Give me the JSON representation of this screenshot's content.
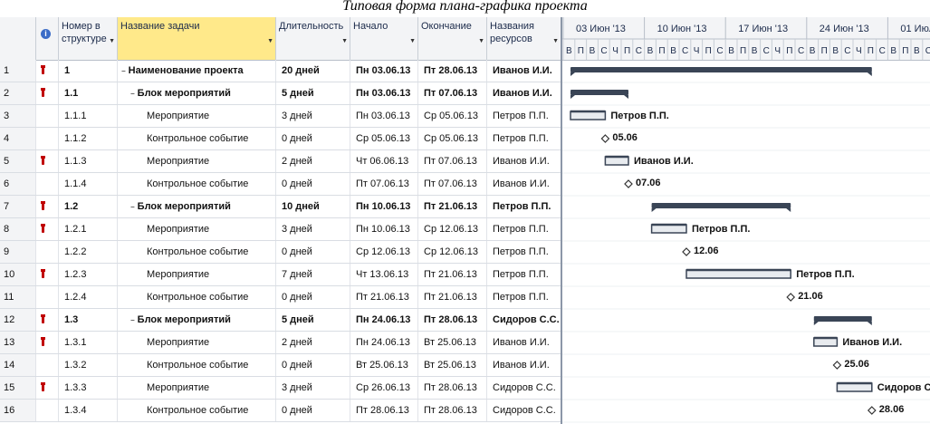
{
  "caption": "Типовая форма плана-графика проекта",
  "columns": {
    "num": "",
    "info_icon": "info-icon",
    "wbs": "Номер в структуре",
    "name": "Название задачи",
    "duration": "Длительность",
    "start": "Начало",
    "finish": "Окончание",
    "resources": "Названия ресурсов"
  },
  "timescale": {
    "weeks": [
      "03 Июн '13",
      "10 Июн '13",
      "17 Июн '13",
      "24 Июн '13",
      "01 Июл '"
    ],
    "days": [
      "В",
      "П",
      "В",
      "С",
      "Ч",
      "П",
      "С"
    ]
  },
  "rows": [
    {
      "num": "1",
      "flag": true,
      "wbs": "1",
      "name": "Наименование проекта",
      "duration": "20 дней",
      "start": "Пн 03.06.13",
      "finish": "Пт 28.06.13",
      "res": "Иванов И.И.",
      "level": 0,
      "type": "summary",
      "bar": {
        "s": 0,
        "e": 26
      },
      "label": ""
    },
    {
      "num": "2",
      "flag": true,
      "wbs": "1.1",
      "name": "Блок мероприятий",
      "duration": "5 дней",
      "start": "Пн 03.06.13",
      "finish": "Пт 07.06.13",
      "res": "Иванов И.И.",
      "level": 1,
      "type": "summary",
      "bar": {
        "s": 0,
        "e": 5
      },
      "label": ""
    },
    {
      "num": "3",
      "flag": false,
      "wbs": "1.1.1",
      "name": "Мероприятие",
      "duration": "3 дней",
      "start": "Пн 03.06.13",
      "finish": "Ср 05.06.13",
      "res": "Петров П.П.",
      "level": 2,
      "type": "task",
      "bar": {
        "s": 0,
        "e": 3
      },
      "label": "Петров П.П."
    },
    {
      "num": "4",
      "flag": false,
      "wbs": "1.1.2",
      "name": "Контрольное событие",
      "duration": "0 дней",
      "start": "Ср 05.06.13",
      "finish": "Ср 05.06.13",
      "res": "Петров П.П.",
      "level": 2,
      "type": "milestone",
      "bar": {
        "s": 3,
        "e": 3
      },
      "label": "05.06"
    },
    {
      "num": "5",
      "flag": true,
      "wbs": "1.1.3",
      "name": "Мероприятие",
      "duration": "2 дней",
      "start": "Чт 06.06.13",
      "finish": "Пт 07.06.13",
      "res": "Иванов И.И.",
      "level": 2,
      "type": "task",
      "bar": {
        "s": 3,
        "e": 5
      },
      "label": "Иванов И.И."
    },
    {
      "num": "6",
      "flag": false,
      "wbs": "1.1.4",
      "name": "Контрольное событие",
      "duration": "0 дней",
      "start": "Пт 07.06.13",
      "finish": "Пт 07.06.13",
      "res": "Иванов И.И.",
      "level": 2,
      "type": "milestone",
      "bar": {
        "s": 5,
        "e": 5
      },
      "label": "07.06"
    },
    {
      "num": "7",
      "flag": true,
      "wbs": "1.2",
      "name": "Блок мероприятий",
      "duration": "10 дней",
      "start": "Пн 10.06.13",
      "finish": "Пт 21.06.13",
      "res": "Петров П.П.",
      "level": 1,
      "type": "summary",
      "bar": {
        "s": 7,
        "e": 19
      },
      "label": ""
    },
    {
      "num": "8",
      "flag": true,
      "wbs": "1.2.1",
      "name": "Мероприятие",
      "duration": "3 дней",
      "start": "Пн 10.06.13",
      "finish": "Ср 12.06.13",
      "res": "Петров П.П.",
      "level": 2,
      "type": "task",
      "bar": {
        "s": 7,
        "e": 10
      },
      "label": "Петров П.П."
    },
    {
      "num": "9",
      "flag": false,
      "wbs": "1.2.2",
      "name": "Контрольное событие",
      "duration": "0 дней",
      "start": "Ср 12.06.13",
      "finish": "Ср 12.06.13",
      "res": "Петров П.П.",
      "level": 2,
      "type": "milestone",
      "bar": {
        "s": 10,
        "e": 10
      },
      "label": "12.06"
    },
    {
      "num": "10",
      "flag": true,
      "wbs": "1.2.3",
      "name": "Мероприятие",
      "duration": "7 дней",
      "start": "Чт 13.06.13",
      "finish": "Пт 21.06.13",
      "res": "Петров П.П.",
      "level": 2,
      "type": "task",
      "bar": {
        "s": 10,
        "e": 19
      },
      "label": "Петров П.П."
    },
    {
      "num": "11",
      "flag": false,
      "wbs": "1.2.4",
      "name": "Контрольное событие",
      "duration": "0 дней",
      "start": "Пт 21.06.13",
      "finish": "Пт 21.06.13",
      "res": "Петров П.П.",
      "level": 2,
      "type": "milestone",
      "bar": {
        "s": 19,
        "e": 19
      },
      "label": "21.06"
    },
    {
      "num": "12",
      "flag": true,
      "wbs": "1.3",
      "name": "Блок мероприятий",
      "duration": "5 дней",
      "start": "Пн 24.06.13",
      "finish": "Пт 28.06.13",
      "res": "Сидоров С.С.",
      "level": 1,
      "type": "summary",
      "bar": {
        "s": 21,
        "e": 26
      },
      "label": ""
    },
    {
      "num": "13",
      "flag": true,
      "wbs": "1.3.1",
      "name": "Мероприятие",
      "duration": "2 дней",
      "start": "Пн 24.06.13",
      "finish": "Вт 25.06.13",
      "res": "Иванов И.И.",
      "level": 2,
      "type": "task",
      "bar": {
        "s": 21,
        "e": 23
      },
      "label": "Иванов И.И."
    },
    {
      "num": "14",
      "flag": false,
      "wbs": "1.3.2",
      "name": "Контрольное событие",
      "duration": "0 дней",
      "start": "Вт 25.06.13",
      "finish": "Вт 25.06.13",
      "res": "Иванов И.И.",
      "level": 2,
      "type": "milestone",
      "bar": {
        "s": 23,
        "e": 23
      },
      "label": "25.06"
    },
    {
      "num": "15",
      "flag": true,
      "wbs": "1.3.3",
      "name": "Мероприятие",
      "duration": "3 дней",
      "start": "Ср 26.06.13",
      "finish": "Пт 28.06.13",
      "res": "Сидоров С.С.",
      "level": 2,
      "type": "task",
      "bar": {
        "s": 23,
        "e": 26
      },
      "label": "Сидоров С.С."
    },
    {
      "num": "16",
      "flag": false,
      "wbs": "1.3.4",
      "name": "Контрольное событие",
      "duration": "0 дней",
      "start": "Пт 28.06.13",
      "finish": "Пт 28.06.13",
      "res": "Сидоров С.С.",
      "level": 2,
      "type": "milestone",
      "bar": {
        "s": 26,
        "e": 26
      },
      "label": "28.06"
    }
  ],
  "colors": {
    "bar": "#3a4556",
    "bar_light": "#e8ebef",
    "milestone": "#333333",
    "flag": "#c00000",
    "header_yellow": "#ffe98a"
  }
}
